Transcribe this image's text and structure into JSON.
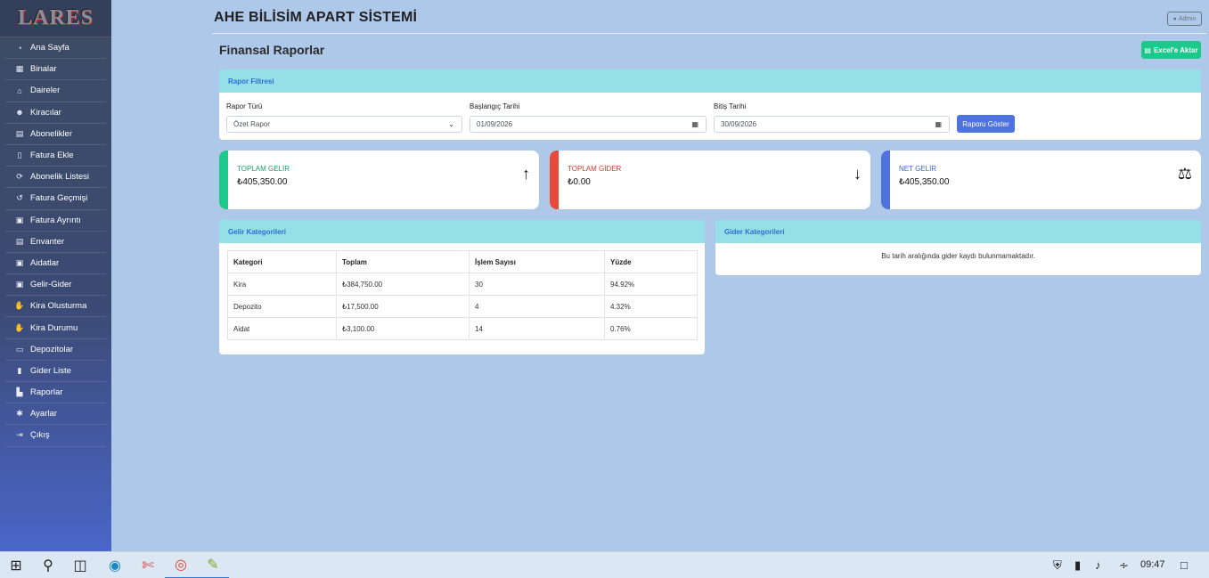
{
  "app": {
    "logo": "LARES",
    "title": "AHE BİLİSİM APART SİSTEMİ",
    "admin_label": "Admin"
  },
  "sidebar": {
    "items": [
      {
        "label": "Ana Sayfa",
        "icon": "dashboard-icon"
      },
      {
        "label": "Binalar",
        "icon": "building-icon"
      },
      {
        "label": "Daireler",
        "icon": "home-icon"
      },
      {
        "label": "Kiracılar",
        "icon": "users-icon"
      },
      {
        "label": "Abonelikler",
        "icon": "clipboard-icon"
      },
      {
        "label": "Fatura Ekle",
        "icon": "file-icon"
      },
      {
        "label": "Abonelik Listesi",
        "icon": "sync-icon"
      },
      {
        "label": "Fatura Geçmişi",
        "icon": "history-icon"
      },
      {
        "label": "Fatura Ayrıntı",
        "icon": "money-icon"
      },
      {
        "label": "Envanter",
        "icon": "clipboard-icon"
      },
      {
        "label": "Aidatlar",
        "icon": "money-icon"
      },
      {
        "label": "Gelir-Gider",
        "icon": "money-icon"
      },
      {
        "label": "Kira Olusturma",
        "icon": "hand-icon"
      },
      {
        "label": "Kira Durumu",
        "icon": "hand-icon"
      },
      {
        "label": "Depozitolar",
        "icon": "card-icon"
      },
      {
        "label": "Gider Liste",
        "icon": "receipt-icon"
      },
      {
        "label": "Raporlar",
        "icon": "chart-icon"
      },
      {
        "label": "Ayarlar",
        "icon": "gear-icon"
      },
      {
        "label": "Çıkış",
        "icon": "logout-icon"
      }
    ]
  },
  "page": {
    "title": "Finansal Raporlar",
    "excel_button": "Excel'e Aktar"
  },
  "filter": {
    "title": "Rapor Filtresi",
    "report_type_label": "Rapor Türü",
    "report_type_value": "Özet Rapor",
    "start_label": "Başlangıç Tarihi",
    "start_value": "01/09/2026",
    "end_label": "Bitiş Tarihi",
    "end_value": "30/09/2026",
    "show_button": "Raporu Göster"
  },
  "stats": {
    "income": {
      "label": "TOPLAM GELİR",
      "value": "₺405,350.00",
      "color": "#1cc88a",
      "icon": "arrow-up-icon"
    },
    "expense": {
      "label": "TOPLAM GİDER",
      "value": "₺0.00",
      "color": "#e74a3b",
      "icon": "arrow-down-icon"
    },
    "net": {
      "label": "NET GELİR",
      "value": "₺405,350.00",
      "color": "#4e73df",
      "icon": "balance-scale-icon"
    }
  },
  "income_categories": {
    "title": "Gelir Kategorileri",
    "headers": [
      "Kategori",
      "Toplam",
      "İşlem Sayısı",
      "Yüzde"
    ],
    "rows": [
      [
        "Kira",
        "₺384,750.00",
        "30",
        "94.92%"
      ],
      [
        "Depozito",
        "₺17,500.00",
        "4",
        "4.32%"
      ],
      [
        "Aidat",
        "₺3,100.00",
        "14",
        "0.76%"
      ]
    ]
  },
  "expense_categories": {
    "title": "Gider Kategorileri",
    "empty_message": "Bu tarih aralığında gider kaydı bulunmamaktadır."
  },
  "taskbar": {
    "time": "09:47"
  }
}
